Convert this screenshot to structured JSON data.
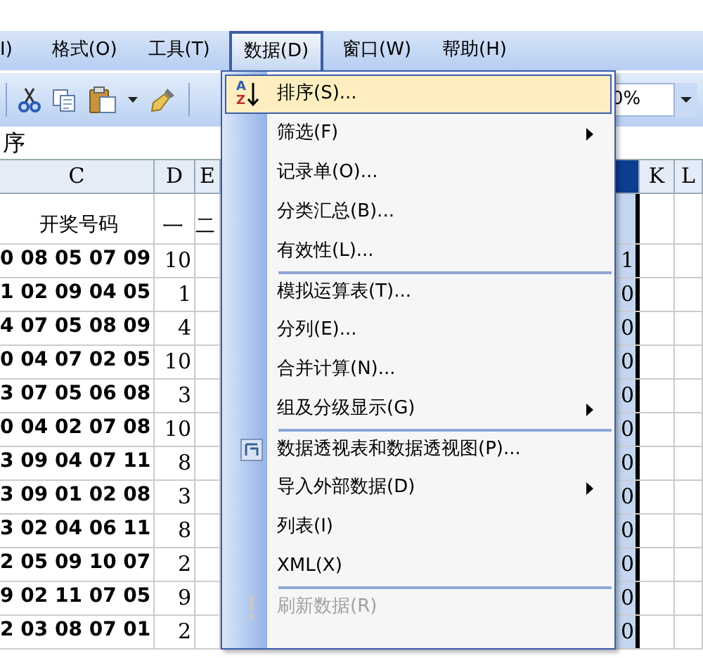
{
  "menu_bar": [
    {
      "label": "I)",
      "selected": false
    },
    {
      "label": "格式(O)",
      "selected": false
    },
    {
      "label": "工具(T)",
      "selected": false
    },
    {
      "label": "数据(D)",
      "selected": true
    },
    {
      "label": "窗口(W)",
      "selected": false
    },
    {
      "label": "帮助(H)",
      "selected": false
    }
  ],
  "zoom": {
    "value": "0%"
  },
  "formula_bar": {
    "value": "序"
  },
  "sheet": {
    "columns_left": [
      {
        "label": "C"
      },
      {
        "label": "D"
      },
      {
        "label": "E"
      }
    ],
    "columns_right": [
      {
        "selected": true
      },
      {
        "label": "K",
        "selected": false
      },
      {
        "label": "L",
        "selected": false
      }
    ],
    "header_row": [
      "开奖号码",
      "一",
      "二"
    ],
    "rows": [
      {
        "c": "0 08 05 07 09",
        "d": "10",
        "j": "1"
      },
      {
        "c": "1 02 09 04 05",
        "d": "1",
        "j": "0"
      },
      {
        "c": "4 07 05 08 09",
        "d": "4",
        "j": "0"
      },
      {
        "c": "0 04 07 02 05",
        "d": "10",
        "j": "0"
      },
      {
        "c": "3 07 05 06 08",
        "d": "3",
        "j": "0"
      },
      {
        "c": "0 04 02 07 08",
        "d": "10",
        "j": "0"
      },
      {
        "c": "3 09 04 07 11",
        "d": "8",
        "j": "0"
      },
      {
        "c": "3 09 01 02 08",
        "d": "3",
        "j": "0"
      },
      {
        "c": "3 02 04 06 11",
        "d": "8",
        "j": "0"
      },
      {
        "c": "2 05 09 10 07",
        "d": "2",
        "j": "0"
      },
      {
        "c": "9 02 11 07 05",
        "d": "9",
        "j": "0"
      },
      {
        "c": "2 03 08 07 01",
        "d": "2",
        "j": "0"
      }
    ]
  },
  "data_menu": [
    {
      "label": "排序(S)...",
      "selected": true,
      "icon_letters": [
        "A",
        "Z"
      ],
      "submenu": false,
      "separator_before": false,
      "disabled": false
    },
    {
      "label": "筛选(F)",
      "selected": false,
      "submenu": true,
      "separator_before": false,
      "disabled": false
    },
    {
      "label": "记录单(O)...",
      "selected": false,
      "submenu": false,
      "separator_before": false,
      "disabled": false
    },
    {
      "label": "分类汇总(B)...",
      "selected": false,
      "submenu": false,
      "separator_before": false,
      "disabled": false
    },
    {
      "label": "有效性(L)...",
      "selected": false,
      "submenu": false,
      "separator_before": false,
      "disabled": false
    },
    {
      "label": "模拟运算表(T)...",
      "selected": false,
      "submenu": false,
      "separator_before": true,
      "disabled": false
    },
    {
      "label": "分列(E)...",
      "selected": false,
      "submenu": false,
      "separator_before": false,
      "disabled": false
    },
    {
      "label": "合并计算(N)...",
      "selected": false,
      "submenu": false,
      "separator_before": false,
      "disabled": false
    },
    {
      "label": "组及分级显示(G)",
      "selected": false,
      "submenu": true,
      "separator_before": false,
      "disabled": false
    },
    {
      "label": "数据透视表和数据透视图(P)...",
      "selected": false,
      "submenu": false,
      "separator_before": true,
      "disabled": false
    },
    {
      "label": "导入外部数据(D)",
      "selected": false,
      "submenu": true,
      "separator_before": false,
      "disabled": false
    },
    {
      "label": "列表(I)",
      "selected": false,
      "submenu": false,
      "separator_before": false,
      "disabled": false
    },
    {
      "label": "XML(X)",
      "selected": false,
      "submenu": false,
      "separator_before": false,
      "disabled": false
    },
    {
      "label": "刷新数据(R)",
      "selected": false,
      "submenu": false,
      "separator_before": true,
      "disabled": true
    }
  ]
}
